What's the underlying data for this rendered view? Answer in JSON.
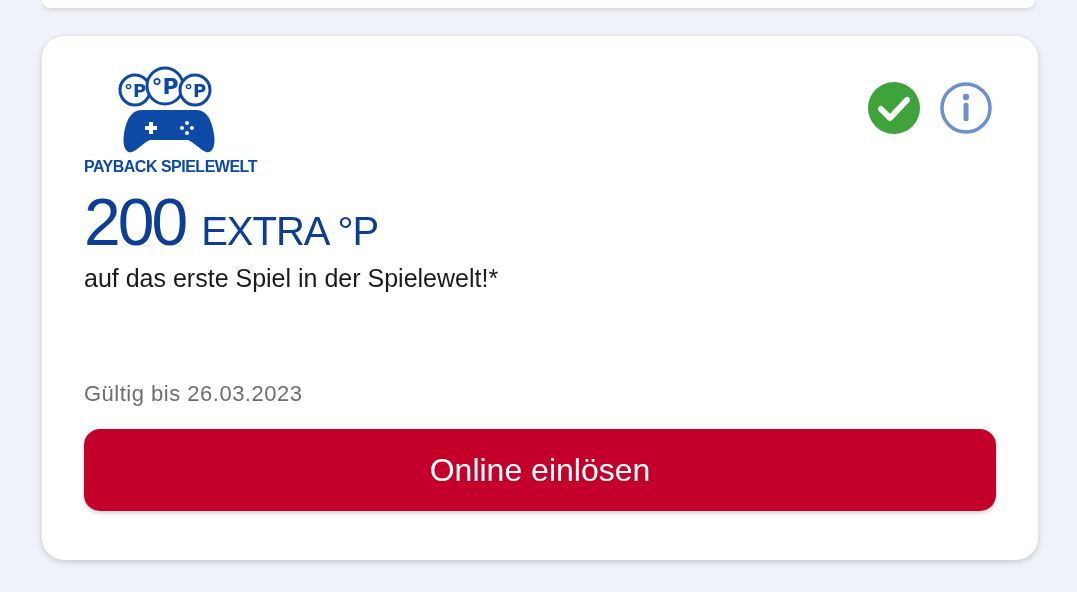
{
  "logo": {
    "coins": [
      "°P",
      "°P",
      "°P"
    ],
    "name": "PAYBACK SPIELEWELT"
  },
  "offer": {
    "amount": "200",
    "unit": "EXTRA °P",
    "description": "auf das erste Spiel in der Spielewelt!*",
    "validity": "Gültig bis 26.03.2023"
  },
  "button": {
    "label": "Online einlösen"
  }
}
